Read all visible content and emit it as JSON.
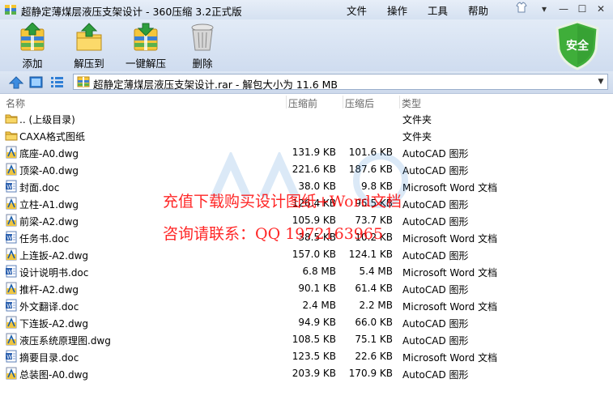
{
  "window": {
    "title": "超静定薄煤层液压支架设计 - 360压缩 3.2正式版",
    "menu": [
      "文件",
      "操作",
      "工具",
      "帮助"
    ]
  },
  "toolbar": {
    "add_label": "添加",
    "extract_label": "解压到",
    "one_click_label": "一键解压",
    "delete_label": "删除",
    "security_label": "安全"
  },
  "address": {
    "path_text": "超静定薄煤层液压支架设计.rar - 解包大小为 11.6 MB"
  },
  "columns": {
    "name": "名称",
    "size": "压缩前",
    "packed": "压缩后",
    "type": "类型"
  },
  "files": [
    {
      "name": ".. (上级目录)",
      "size": "",
      "packed": "",
      "type": "文件夹",
      "icon": "folder-icon"
    },
    {
      "name": "CAXA格式图纸",
      "size": "",
      "packed": "",
      "type": "文件夹",
      "icon": "folder-icon"
    },
    {
      "name": "底座-A0.dwg",
      "size": "131.9 KB",
      "packed": "101.6 KB",
      "type": "AutoCAD 图形",
      "icon": "dwg-icon"
    },
    {
      "name": "顶梁-A0.dwg",
      "size": "221.6 KB",
      "packed": "187.6 KB",
      "type": "AutoCAD 图形",
      "icon": "dwg-icon"
    },
    {
      "name": "封面.doc",
      "size": "38.0 KB",
      "packed": "9.8 KB",
      "type": "Microsoft Word 文档",
      "icon": "doc-icon"
    },
    {
      "name": "立柱-A1.dwg",
      "size": "126.4 KB",
      "packed": "95.5 KB",
      "type": "AutoCAD 图形",
      "icon": "dwg-icon"
    },
    {
      "name": "前梁-A2.dwg",
      "size": "105.9 KB",
      "packed": "73.7 KB",
      "type": "AutoCAD 图形",
      "icon": "dwg-icon"
    },
    {
      "name": "任务书.doc",
      "size": "38.5 KB",
      "packed": "10.2 KB",
      "type": "Microsoft Word 文档",
      "icon": "doc-icon"
    },
    {
      "name": "上连扳-A2.dwg",
      "size": "157.0 KB",
      "packed": "124.1 KB",
      "type": "AutoCAD 图形",
      "icon": "dwg-icon"
    },
    {
      "name": "设计说明书.doc",
      "size": "6.8 MB",
      "packed": "5.4 MB",
      "type": "Microsoft Word 文档",
      "icon": "doc-icon"
    },
    {
      "name": "推杆-A2.dwg",
      "size": "90.1 KB",
      "packed": "61.4 KB",
      "type": "AutoCAD 图形",
      "icon": "dwg-icon"
    },
    {
      "name": "外文翻译.doc",
      "size": "2.4 MB",
      "packed": "2.2 MB",
      "type": "Microsoft Word 文档",
      "icon": "doc-icon"
    },
    {
      "name": "下连扳-A2.dwg",
      "size": "94.9 KB",
      "packed": "66.0 KB",
      "type": "AutoCAD 图形",
      "icon": "dwg-icon"
    },
    {
      "name": "液压系统原理图.dwg",
      "size": "108.5 KB",
      "packed": "75.1 KB",
      "type": "AutoCAD 图形",
      "icon": "dwg-icon"
    },
    {
      "name": "摘要目录.doc",
      "size": "123.5 KB",
      "packed": "22.6 KB",
      "type": "Microsoft Word 文档",
      "icon": "doc-icon"
    },
    {
      "name": "总装图-A0.dwg",
      "size": "203.9 KB",
      "packed": "170.9 KB",
      "type": "AutoCAD 图形",
      "icon": "dwg-icon"
    }
  ],
  "watermark": {
    "line1": "充值下载购买设计图纸+Word文档",
    "line2": "咨询请联系：QQ 1972163965"
  }
}
